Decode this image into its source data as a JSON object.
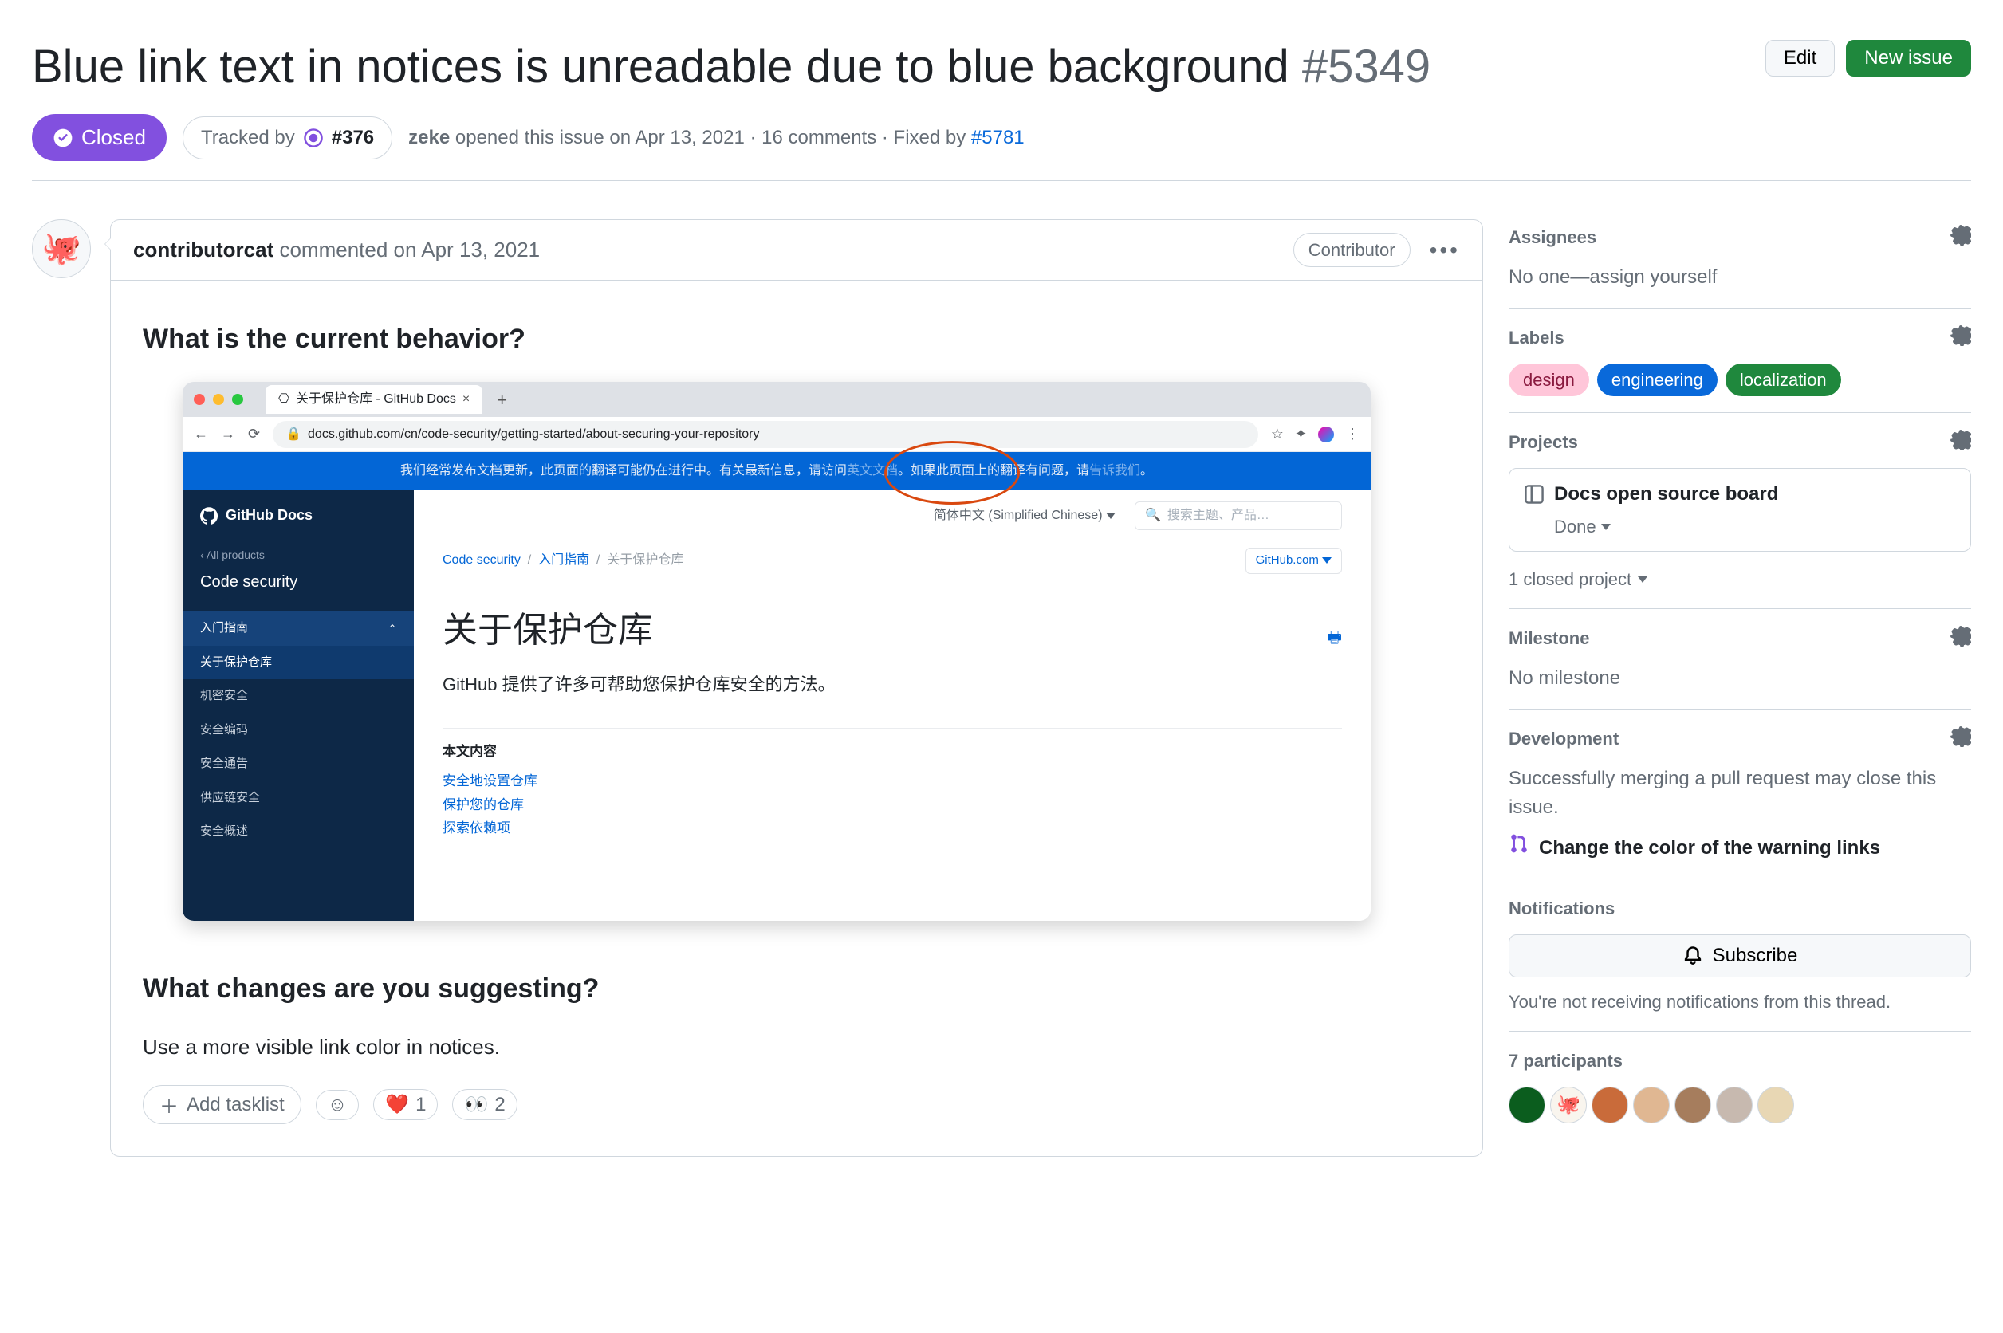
{
  "header": {
    "title": "Blue link text in notices is unreadable due to blue background",
    "issue_number": "#5349",
    "edit_btn": "Edit",
    "new_issue_btn": "New issue"
  },
  "meta": {
    "state": "Closed",
    "tracked_by_label": "Tracked by",
    "tracked_by_ref": "#376",
    "author": "zeke",
    "opened_text": "opened this issue on Apr 13, 2021 · 16 comments · Fixed by",
    "fixed_by_ref": "#5781"
  },
  "comment": {
    "author": "contributorcat",
    "verb": "commented",
    "date": "on Apr 13, 2021",
    "role_badge": "Contributor",
    "h1": "What is the current behavior?",
    "h2": "What changes are you suggesting?",
    "suggestion_text": "Use a more visible link color in notices.",
    "add_tasklist": "Add tasklist",
    "reaction_smile": "☺",
    "reaction_heart": "❤️",
    "reaction_heart_count": "1",
    "reaction_eyes": "👀",
    "reaction_eyes_count": "2"
  },
  "screenshot": {
    "tab_title": "关于保护仓库 - GitHub Docs",
    "url": "docs.github.com/cn/code-security/getting-started/about-securing-your-repository",
    "banner_pre": "我们经常发布文档更新，此页面的翻译可能仍在进行中。有关最新信息，请访问",
    "banner_link": "英文文档",
    "banner_mid": "。如果此页面上的翻译有问题，请",
    "banner_link2": "告诉我们",
    "banner_end": "。",
    "sidebar_brand": "GitHub Docs",
    "sidebar_back": "All products",
    "sidebar_section": "Code security",
    "sidebar_items": [
      "入门指南",
      "关于保护仓库",
      "机密安全",
      "安全编码",
      "安全通告",
      "供应链安全",
      "安全概述"
    ],
    "lang_label": "简体中文 (Simplified Chinese)",
    "search_placeholder": "搜索主题、产品…",
    "crumbs": [
      "Code security",
      "入门指南",
      "关于保护仓库"
    ],
    "ghcom": "GitHub.com",
    "page_h1": "关于保护仓库",
    "page_p": "GitHub 提供了许多可帮助您保护仓库安全的方法。",
    "toc_title": "本文内容",
    "toc_items": [
      "安全地设置仓库",
      "保护您的仓库",
      "探索依赖项"
    ]
  },
  "sidebar": {
    "assignees": {
      "title": "Assignees",
      "none": "No one—",
      "assign": "assign yourself"
    },
    "labels": {
      "title": "Labels",
      "items": [
        "design",
        "engineering",
        "localization"
      ]
    },
    "projects": {
      "title": "Projects",
      "card_title": "Docs open source board",
      "card_status": "Done",
      "closed_text": "1 closed project"
    },
    "milestone": {
      "title": "Milestone",
      "text": "No milestone"
    },
    "development": {
      "title": "Development",
      "text": "Successfully merging a pull request may close this issue.",
      "link": "Change the color of the warning links"
    },
    "notifications": {
      "title": "Notifications",
      "button": "Subscribe",
      "note": "You're not receiving notifications from this thread."
    },
    "participants": {
      "title": "7 participants"
    }
  }
}
